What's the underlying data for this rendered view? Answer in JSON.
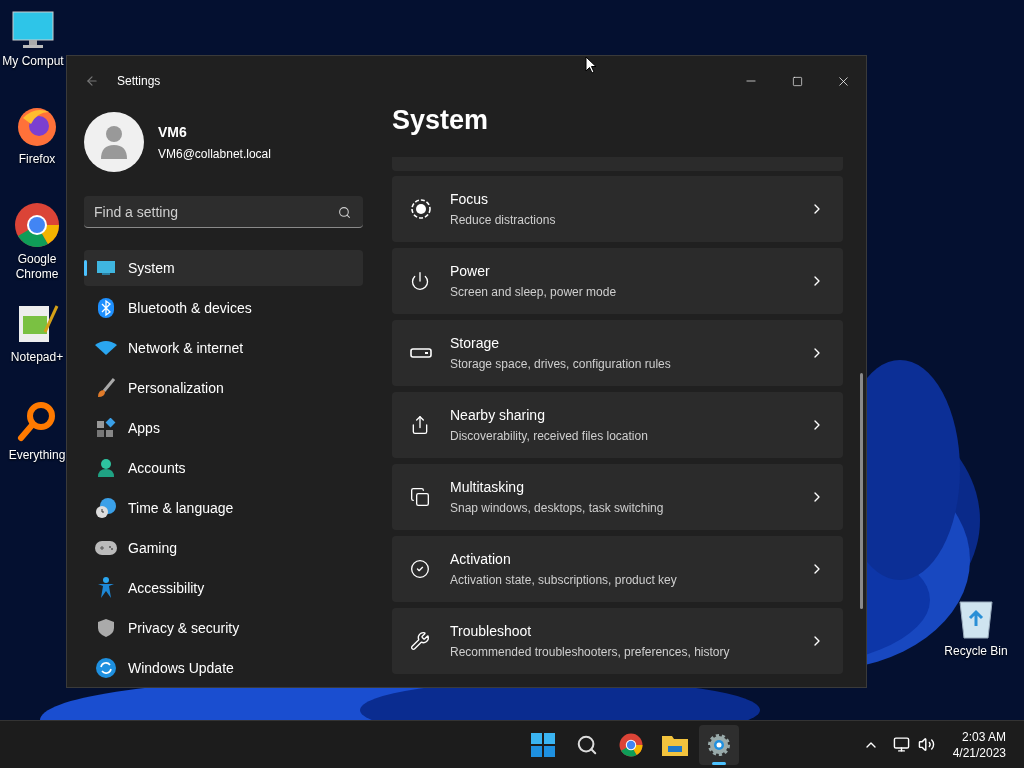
{
  "desktop_icons": [
    {
      "label": "My Comput"
    },
    {
      "label": "Firefox"
    },
    {
      "label": "Google Chrome"
    },
    {
      "label": "Notepad+"
    },
    {
      "label": "Everything"
    },
    {
      "label": "Recycle Bin"
    }
  ],
  "window": {
    "title": "Settings"
  },
  "profile": {
    "name": "VM6",
    "email": "VM6@collabnet.local"
  },
  "search": {
    "placeholder": "Find a setting"
  },
  "nav_items": [
    {
      "label": "System",
      "selected": true
    },
    {
      "label": "Bluetooth & devices",
      "selected": false
    },
    {
      "label": "Network & internet",
      "selected": false
    },
    {
      "label": "Personalization",
      "selected": false
    },
    {
      "label": "Apps",
      "selected": false
    },
    {
      "label": "Accounts",
      "selected": false
    },
    {
      "label": "Time & language",
      "selected": false
    },
    {
      "label": "Gaming",
      "selected": false
    },
    {
      "label": "Accessibility",
      "selected": false
    },
    {
      "label": "Privacy & security",
      "selected": false
    },
    {
      "label": "Windows Update",
      "selected": false
    }
  ],
  "page_title": "System",
  "cards": [
    {
      "title": "Focus",
      "subtitle": "Reduce distractions"
    },
    {
      "title": "Power",
      "subtitle": "Screen and sleep, power mode"
    },
    {
      "title": "Storage",
      "subtitle": "Storage space, drives, configuration rules"
    },
    {
      "title": "Nearby sharing",
      "subtitle": "Discoverability, received files location"
    },
    {
      "title": "Multitasking",
      "subtitle": "Snap windows, desktops, task switching"
    },
    {
      "title": "Activation",
      "subtitle": "Activation state, subscriptions, product key"
    },
    {
      "title": "Troubleshoot",
      "subtitle": "Recommended troubleshooters, preferences, history"
    }
  ],
  "taskbar": {
    "apps": [
      {
        "selected": false
      },
      {
        "selected": false
      },
      {
        "selected": false
      },
      {
        "selected": false
      },
      {
        "selected": true
      }
    ],
    "time": "2:03 AM",
    "date": "4/21/2023"
  }
}
